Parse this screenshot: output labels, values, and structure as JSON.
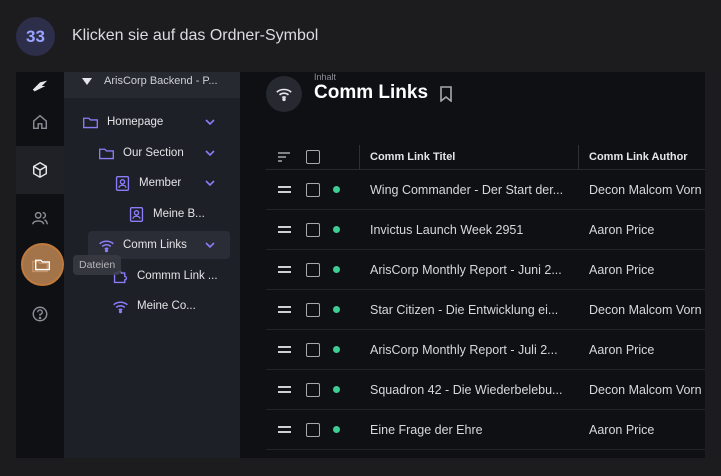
{
  "instruction": {
    "step": "33",
    "text": "Klicken sie auf das Ordner-Symbol"
  },
  "rail": {
    "items": [
      {
        "name": "logo-icon"
      },
      {
        "name": "home-icon"
      },
      {
        "name": "box-icon"
      },
      {
        "name": "users-icon"
      },
      {
        "name": "folder-icon"
      },
      {
        "name": "help-icon"
      }
    ],
    "tooltip": "Dateien"
  },
  "tree": {
    "header": "ArisCorp Backend - P...",
    "items": [
      {
        "label": "Homepage"
      },
      {
        "label": "Our Section"
      },
      {
        "label": "Member"
      },
      {
        "label": "Meine B..."
      },
      {
        "label": "Comm Links"
      },
      {
        "label": "Commm Link ..."
      },
      {
        "label": "Meine Co..."
      }
    ]
  },
  "main": {
    "breadcrumb": "Inhalt",
    "title": "Comm Links",
    "columns": {
      "title": "Comm Link Titel",
      "author": "Comm Link Author"
    },
    "rows": [
      {
        "title": "Wing Commander - Der Start der...",
        "author": "Decon Malcom Vorn"
      },
      {
        "title": "Invictus Launch Week 2951",
        "author": "Aaron Price"
      },
      {
        "title": "ArisCorp Monthly Report - Juni 2...",
        "author": "Aaron Price"
      },
      {
        "title": "Star Citizen - Die Entwicklung ei...",
        "author": "Decon Malcom Vorn"
      },
      {
        "title": "ArisCorp Monthly Report - Juli 2...",
        "author": "Aaron Price"
      },
      {
        "title": "Squadron 42 - Die Wiederbelebu...",
        "author": "Decon Malcom Vorn"
      },
      {
        "title": "Eine Frage der Ehre",
        "author": "Aaron Price"
      }
    ]
  },
  "colors": {
    "accent": "#8b7cf8",
    "status": "#3ccf91",
    "highlight": "#d6965c"
  }
}
